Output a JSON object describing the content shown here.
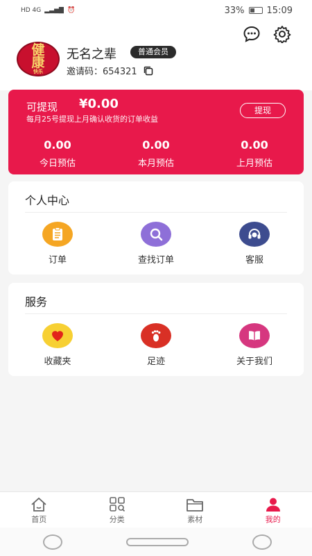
{
  "status_bar": {
    "left_icons": "HD 4G",
    "battery": "33%",
    "time": "15:09"
  },
  "header": {
    "chat_icon": "chat-bubble-icon",
    "settings_icon": "gear-icon",
    "avatar": {
      "line1": "健",
      "line2": "康",
      "line3": "快乐"
    },
    "username": "无名之辈",
    "member_badge": "普通会员",
    "invite_label": "邀请码：654321",
    "copy_icon": "copy-icon"
  },
  "earnings": {
    "label": "可提现",
    "amount": "¥0.00",
    "note": "每月25号提现上月确认收货的订单收益",
    "withdraw_label": "提现",
    "stats": [
      {
        "value": "0.00",
        "label": "今日预估"
      },
      {
        "value": "0.00",
        "label": "本月预估"
      },
      {
        "value": "0.00",
        "label": "上月预估"
      }
    ]
  },
  "personal_center": {
    "title": "个人中心",
    "items": [
      {
        "label": "订单",
        "icon": "clipboard-icon",
        "color": "#f5a623"
      },
      {
        "label": "查找订单",
        "icon": "search-icon",
        "color": "#8e6fd8"
      },
      {
        "label": "客服",
        "icon": "headset-icon",
        "color": "#3d4c8f"
      }
    ]
  },
  "services": {
    "title": "服务",
    "items": [
      {
        "label": "收藏夹",
        "icon": "heart-icon",
        "color": "#f7d033"
      },
      {
        "label": "足迹",
        "icon": "footprint-icon",
        "color": "#d93025"
      },
      {
        "label": "关于我们",
        "icon": "book-icon",
        "color": "#d6377f"
      }
    ]
  },
  "bottom_nav": {
    "items": [
      {
        "label": "首页",
        "icon": "home-icon"
      },
      {
        "label": "分类",
        "icon": "grid-icon"
      },
      {
        "label": "素材",
        "icon": "folder-icon"
      },
      {
        "label": "我的",
        "icon": "person-icon",
        "active": true
      }
    ]
  },
  "colors": {
    "accent": "#e8194b"
  }
}
